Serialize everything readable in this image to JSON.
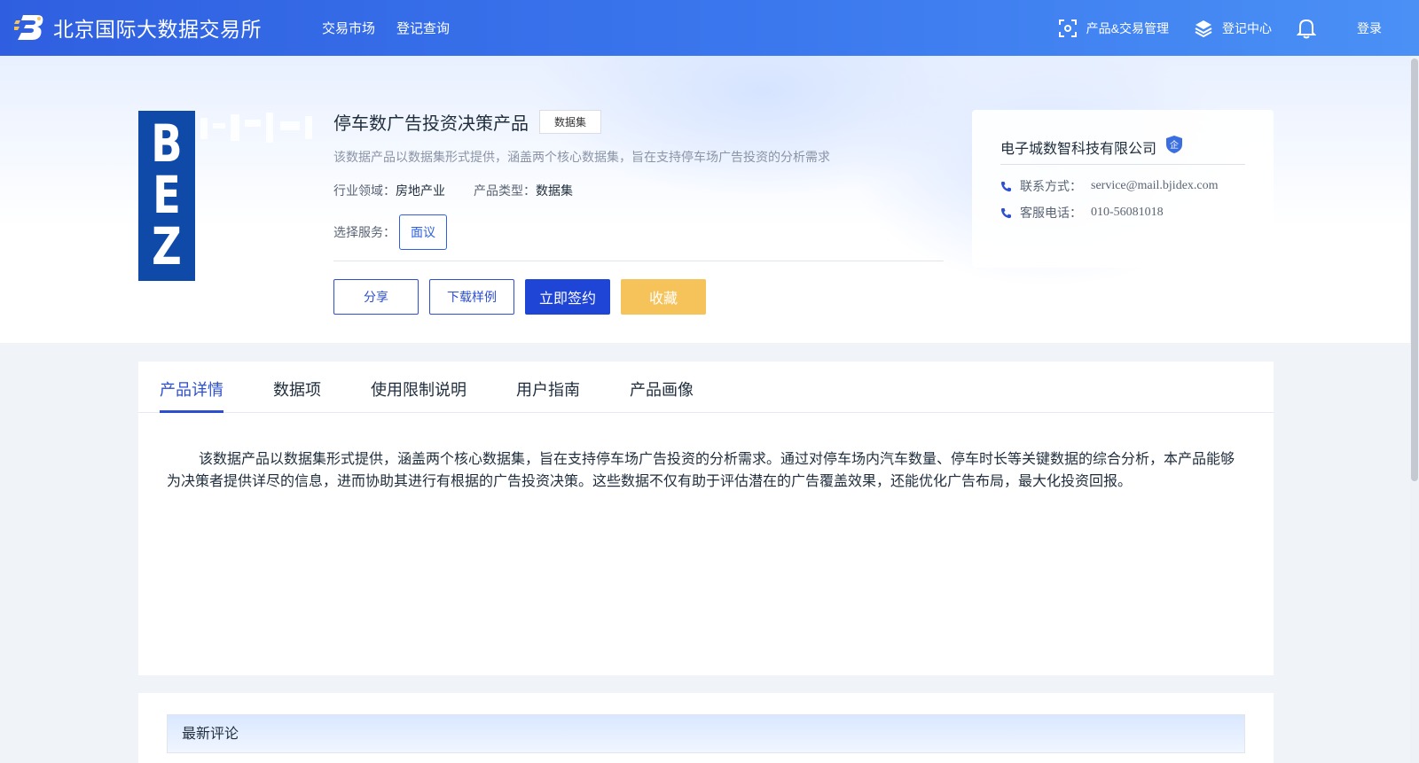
{
  "header": {
    "brand": "北京国际大数据交易所",
    "nav": [
      "交易市场",
      "登记查询"
    ],
    "product_mgmt": "产品&交易管理",
    "register_center": "登记中心",
    "login": "登录"
  },
  "product": {
    "thumbnail_text": "BEZ",
    "title": "停车数广告投资决策产品",
    "tag": "数据集",
    "description": "该数据产品以数据集形式提供，涵盖两个核心数据集，旨在支持停车场广告投资的分析需求",
    "industry_label": "行业领域：",
    "industry_value": "房地产业",
    "type_label": "产品类型：",
    "type_value": "数据集",
    "service_label": "选择服务：",
    "service_option": "面议",
    "buttons": {
      "share": "分享",
      "download": "下载样例",
      "sign": "立即签约",
      "favorite": "收藏"
    }
  },
  "company": {
    "name": "电子城数智科技有限公司",
    "badge": "企",
    "contact_label": "联系方式：",
    "contact_value": "service@mail.bjidex.com",
    "phone_label": "客服电话：",
    "phone_value": "010-56081018"
  },
  "tabs": [
    "产品详情",
    "数据项",
    "使用限制说明",
    "用户指南",
    "产品画像"
  ],
  "detail_text": "该数据产品以数据集形式提供，涵盖两个核心数据集，旨在支持停车场广告投资的分析需求。通过对停车场内汽车数量、停车时长等关键数据的综合分析，本产品能够为决策者提供详尽的信息，进而协助其进行有根据的广告投资决策。这些数据不仅有助于评估潜在的广告覆盖效果，还能优化广告布局，最大化投资回报。",
  "comments": {
    "title": "最新评论"
  },
  "colors": {
    "primary": "#1f45d6",
    "accent_gold": "#f5c35a",
    "header_start": "#2f5fe0",
    "header_end": "#4a90f5"
  }
}
